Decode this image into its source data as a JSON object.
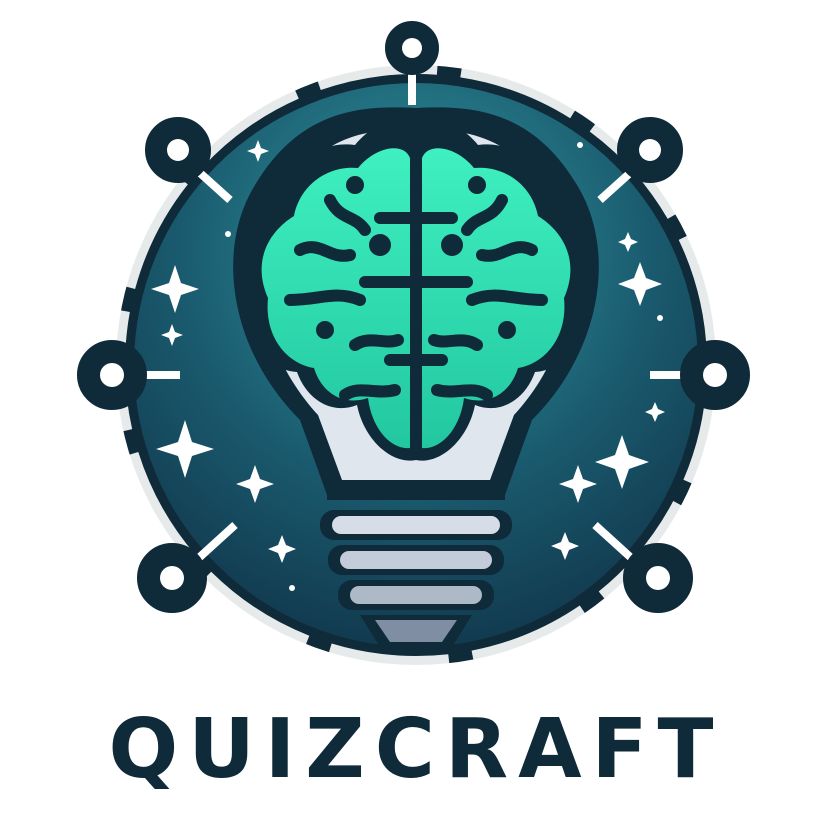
{
  "brand": {
    "name": "QUIZCRAFT"
  },
  "colors": {
    "dark_outline": "#0f2a38",
    "circle_top": "#2f9aa3",
    "circle_bottom": "#123a4f",
    "brain_fill": "#32e6b4",
    "brain_shade": "#1fbf9c",
    "bulb_base": "#cfd6e0",
    "star": "#ffffff"
  },
  "icons": [
    "lightbulb-icon",
    "brain-icon",
    "sparkle-icon",
    "network-node-icon"
  ]
}
